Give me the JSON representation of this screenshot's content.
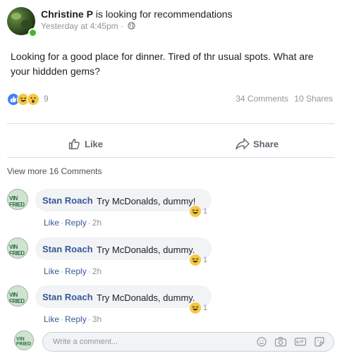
{
  "post": {
    "author": "Christine P",
    "action": "is looking for recommendations",
    "timestamp": "Yesterday at 4:45pm",
    "separator": "·",
    "privacy_icon": "globe-icon",
    "text": "Looking for a good place for dinner. Tired of thr usual spots. What are your hiddden gems?",
    "reaction_icons": [
      "like-icon",
      "haha-icon",
      "wow-icon"
    ],
    "reaction_count": "9",
    "comments_count": "34 Comments",
    "shares_count": "10 Shares"
  },
  "actions": {
    "like_label": "Like",
    "share_label": "Share"
  },
  "view_more": "View more 16 Comments",
  "avatar_text": "VIN FRIED",
  "comments": [
    {
      "author": "Stan Roach",
      "text": "Try McDonalds, dummy!",
      "reaction_count": "1",
      "like": "Like",
      "reply": "Reply",
      "time": "2h"
    },
    {
      "author": "Stan Roach",
      "text": "Try McDonalds, dummy.",
      "reaction_count": "1",
      "like": "Like",
      "reply": "Reply",
      "time": "2h"
    },
    {
      "author": "Stan Roach",
      "text": "Try McDonalds, dummy.",
      "reaction_count": "1",
      "like": "Like",
      "reply": "Reply",
      "time": "3h"
    }
  ],
  "composer": {
    "placeholder": "Write a comment...",
    "icons": [
      "emoji-icon",
      "camera-icon",
      "gif-icon",
      "sticker-icon"
    ]
  },
  "colors": {
    "link_blue": "#385898",
    "online_green": "#42b72a",
    "like_blue": "#4080ff",
    "haha_yellow": "#f7c845"
  }
}
